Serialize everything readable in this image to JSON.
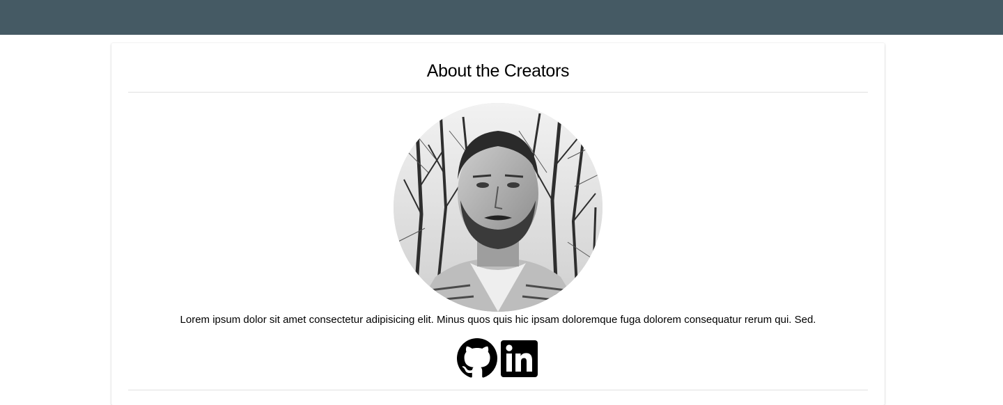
{
  "header": {
    "bar_color": "#455a64"
  },
  "about": {
    "title": "About the Creators",
    "creators": [
      {
        "bio": "Lorem ipsum dolor sit amet consectetur adipisicing elit. Minus quos quis hic ipsam doloremque fuga dolorem consequatur rerum qui. Sed.",
        "photo_icon": "profile-photo",
        "links": [
          {
            "icon": "github-icon"
          },
          {
            "icon": "linkedin-icon"
          }
        ]
      }
    ]
  }
}
